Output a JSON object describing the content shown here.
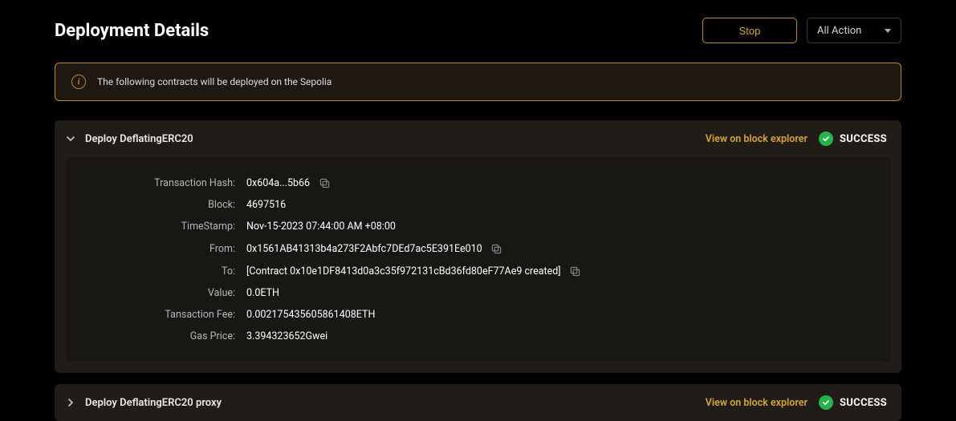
{
  "header": {
    "title": "Deployment Details",
    "stop_label": "Stop",
    "action_dropdown": "All Action"
  },
  "notice": {
    "text": "The following contracts will be deployed on the Sepolia"
  },
  "sections": [
    {
      "expanded": true,
      "title": "Deploy DeflatingERC20",
      "explorer_label": "View on block explorer",
      "status_label": "SUCCESS",
      "rows": [
        {
          "label": "Transaction Hash:",
          "value": "0x604a...5b66",
          "copy": true
        },
        {
          "label": "Block:",
          "value": "4697516",
          "copy": false
        },
        {
          "label": "TimeStamp:",
          "value": "Nov-15-2023 07:44:00 AM +08:00",
          "copy": false
        },
        {
          "label": "From:",
          "value": "0x1561AB41313b4a273F2Abfc7DEd7ac5E391Ee010",
          "copy": true
        },
        {
          "label": "To:",
          "value": "[Contract 0x10e1DF8413d0a3c35f972131cBd36fd80eF77Ae9 created]",
          "copy": true
        },
        {
          "label": "Value:",
          "value": "0.0ETH",
          "copy": false
        },
        {
          "label": "Tansaction Fee:",
          "value": "0.002175435605861408ETH",
          "copy": false
        },
        {
          "label": "Gas Price:",
          "value": "3.394323652Gwei",
          "copy": false
        }
      ]
    },
    {
      "expanded": false,
      "title": "Deploy DeflatingERC20 proxy",
      "explorer_label": "View on block explorer",
      "status_label": "SUCCESS"
    }
  ]
}
